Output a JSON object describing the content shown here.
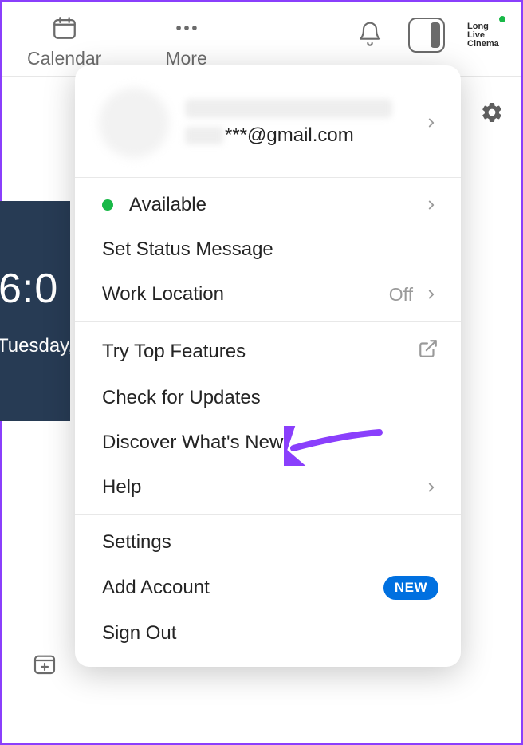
{
  "toolbar": {
    "calendar_label": "Calendar",
    "more_label": "More"
  },
  "profile": {
    "brand_line1": "Long",
    "brand_line2": "Live",
    "brand_line3": "Cinema"
  },
  "clock": {
    "time": "6:0",
    "day": "Tuesday,"
  },
  "menu": {
    "account": {
      "email_suffix": "***@gmail.com"
    },
    "status": {
      "available_label": "Available",
      "set_status_label": "Set Status Message",
      "work_location_label": "Work Location",
      "work_location_value": "Off"
    },
    "features": {
      "top_features_label": "Try Top Features",
      "check_updates_label": "Check for Updates",
      "whats_new_label": "Discover What's New",
      "help_label": "Help"
    },
    "settings": {
      "settings_label": "Settings",
      "add_account_label": "Add Account",
      "add_account_badge": "NEW",
      "sign_out_label": "Sign Out"
    }
  }
}
